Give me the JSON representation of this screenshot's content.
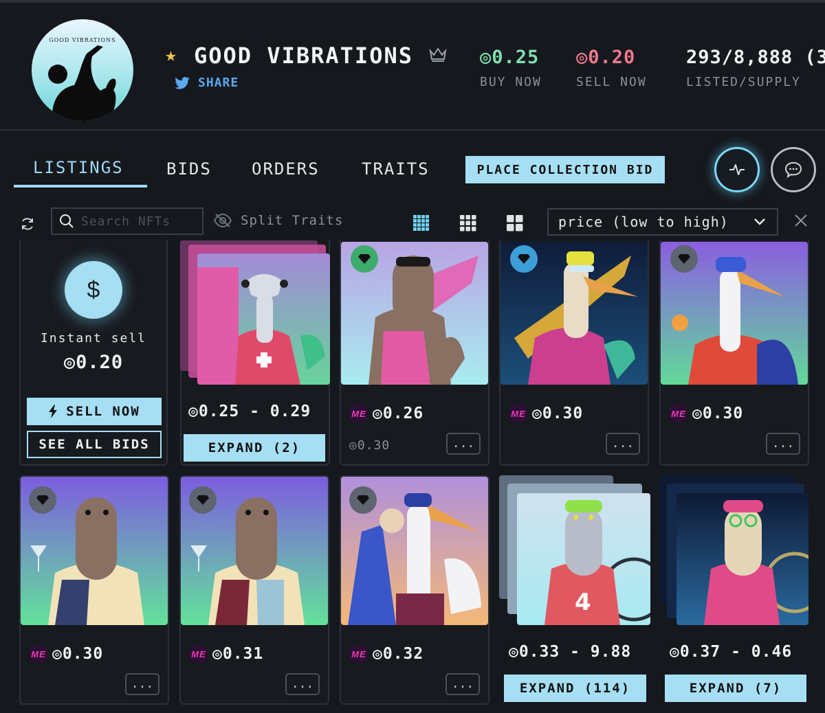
{
  "collection": {
    "logo_text": "GOOD VIBRATIONS",
    "title": "GOOD VIBRATIONS",
    "share_label": "SHARE",
    "stats": [
      {
        "value": "◎0.25",
        "label": "BUY NOW"
      },
      {
        "value": "◎0.20",
        "label": "SELL NOW"
      },
      {
        "value": "293/8,888 (3",
        "label": "LISTED/SUPPLY"
      }
    ]
  },
  "tabs": [
    {
      "label": "LISTINGS",
      "active": true
    },
    {
      "label": "BIDS"
    },
    {
      "label": "ORDERS"
    },
    {
      "label": "TRAITS"
    }
  ],
  "place_bid_label": "PLACE COLLECTION BID",
  "toolbar": {
    "search_placeholder": "Search NFTs",
    "split_traits_label": "Split Traits",
    "sort_value": "price (low to high)"
  },
  "instant_sell": {
    "label": "Instant sell",
    "value": "◎0.20",
    "sell_now_label": "SELL NOW",
    "see_bids_label": "SEE ALL BIDS",
    "dollar": "$"
  },
  "listings": [
    {
      "price": "◎0.25 - 0.29",
      "expand_label": "EXPAND (2)",
      "stacked": true
    },
    {
      "price": "◎0.26",
      "sub_price": "◎0.30",
      "more": "...",
      "marketplace": "ME"
    },
    {
      "price": "◎0.30",
      "more": "...",
      "marketplace": "ME"
    },
    {
      "price": "◎0.30",
      "more": "...",
      "marketplace": "ME"
    },
    {
      "price": "◎0.30",
      "more": "...",
      "marketplace": "ME"
    },
    {
      "price": "◎0.31",
      "more": "...",
      "marketplace": "ME"
    },
    {
      "price": "◎0.32",
      "more": "...",
      "marketplace": "ME"
    },
    {
      "price": "◎0.33 - 9.88",
      "expand_label": "EXPAND (114)",
      "stacked": true
    },
    {
      "price": "◎0.37 - 0.46",
      "expand_label": "EXPAND (7)",
      "stacked": true
    }
  ],
  "colors": {
    "accent": "#a6dff4",
    "buy": "#7fe0b0",
    "sell": "#f07890",
    "magic_eden": "#e93ab5"
  }
}
